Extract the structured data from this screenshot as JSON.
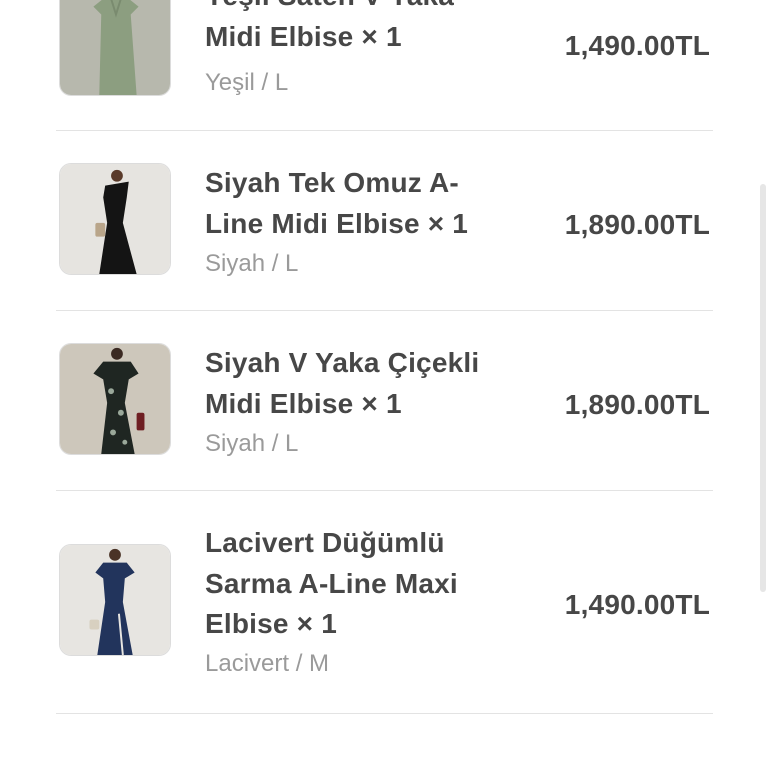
{
  "order_items": [
    {
      "title_line1": "Yeşil Saten V Yaka",
      "title_line2": "Midi Elbise × 1",
      "title_line3": "",
      "variant": "Yeşil / L",
      "price": "1,490.00TL",
      "image": "green-satin-dress-photo"
    },
    {
      "title_line1": "Siyah Tek Omuz A-",
      "title_line2": "Line Midi Elbise × 1",
      "title_line3": "",
      "variant": "Siyah / L",
      "price": "1,890.00TL",
      "image": "black-one-shoulder-dress-photo"
    },
    {
      "title_line1": "Siyah V Yaka Çiçekli",
      "title_line2": "Midi Elbise × 1",
      "title_line3": "",
      "variant": "Siyah / L",
      "price": "1,890.00TL",
      "image": "black-floral-dress-photo"
    },
    {
      "title_line1": "Lacivert Düğümlü",
      "title_line2": "Sarma A-Line Maxi",
      "title_line3": "Elbise × 1",
      "variant": "Lacivert / M",
      "price": "1,490.00TL",
      "image": "navy-wrap-dress-photo"
    }
  ],
  "colors": {
    "text": "#474747",
    "muted": "#9a9a9a",
    "divider": "#e3e3e3"
  }
}
